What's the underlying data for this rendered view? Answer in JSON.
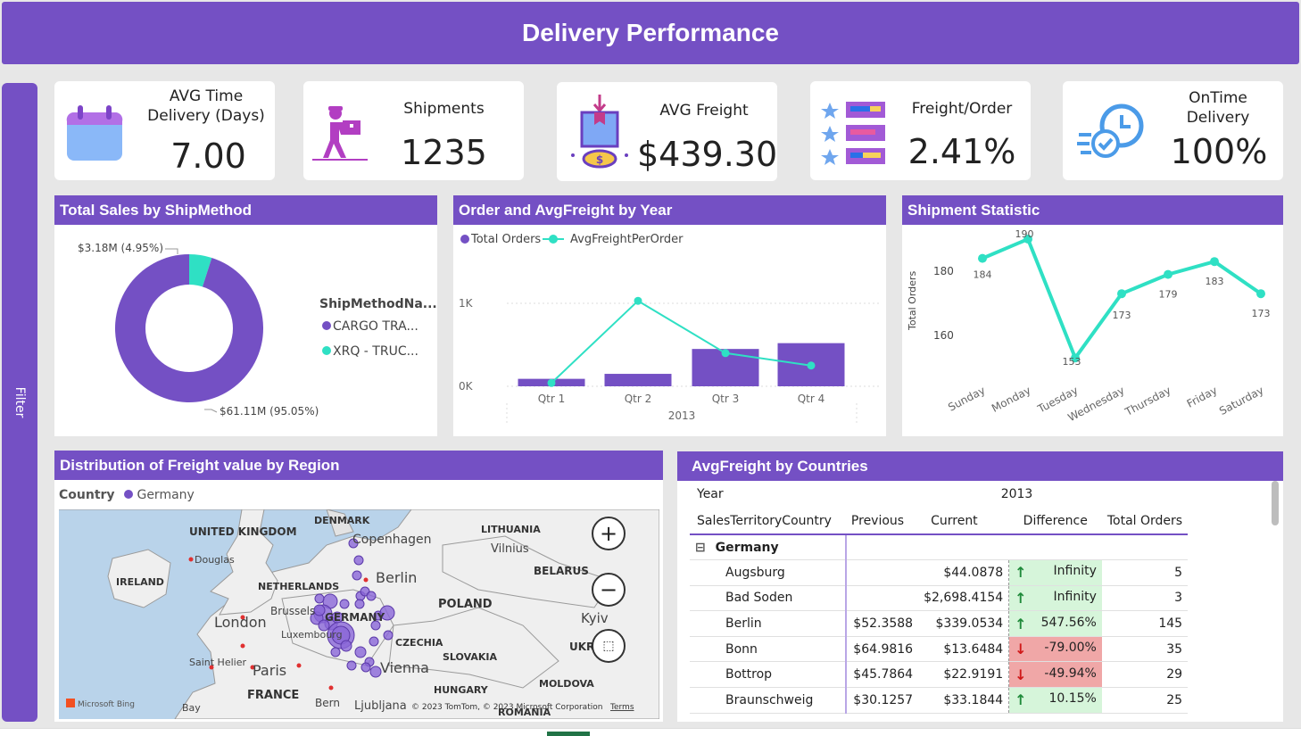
{
  "header": {
    "title": "Delivery Performance"
  },
  "filter": {
    "label": "Filter"
  },
  "kpis": {
    "avg_time": {
      "label_line1": "AVG Time",
      "label_line2": "Delivery (Days)",
      "value": "7.00",
      "icon": "calendar-icon"
    },
    "shipments": {
      "label": "Shipments",
      "value": "1235",
      "icon": "delivery-person-icon"
    },
    "avg_freight": {
      "label": "AVG Freight",
      "value": "$439.30",
      "icon": "package-money-icon"
    },
    "freight_order": {
      "label": "Freight/Order",
      "value": "2.41%",
      "icon": "star-list-icon"
    },
    "ontime": {
      "label_line1": "OnTime",
      "label_line2": "Delivery",
      "value": "100%",
      "icon": "fast-clock-icon"
    }
  },
  "colors": {
    "purple": "#7450c4",
    "teal": "#2fe0c4",
    "up_bg": "#d6f5da",
    "down_bg": "#f0a7a7"
  },
  "donut": {
    "title": "Total Sales by ShipMethod",
    "legend_title": "ShipMethodNa...",
    "label_small": "$3.18M (4.95%)",
    "label_large": "$61.11M (95.05%)",
    "legend": [
      "CARGO TRA...",
      "XRQ - TRUC..."
    ]
  },
  "combo": {
    "title": "Order and AvgFreight by Year",
    "legend_orders": "Total Orders",
    "legend_freight": "AvgFreightPerOrder",
    "y_ticks": [
      "1K",
      "0K"
    ],
    "year": "2013"
  },
  "shipstat": {
    "title": "Shipment Statistic",
    "ylabel": "Total Orders",
    "y_ticks": [
      "180",
      "160"
    ]
  },
  "map": {
    "title": "Distribution of Freight value by Region",
    "legend_field": "Country",
    "legend_item": "Germany",
    "labels": {
      "uk": "UNITED KINGDOM",
      "denmark": "DENMARK",
      "copenhagen": "Copenhagen",
      "lithuania": "LITHUANIA",
      "vilnius": "Vilnius",
      "belarus": "BELARUS",
      "ireland": "IRELAND",
      "netherlands": "NETHERLANDS",
      "berlin": "Berlin",
      "poland": "POLAND",
      "london": "London",
      "brussels": "Brussels",
      "germany": "GERMANY",
      "kyiv": "Kyiv",
      "luxembourg": "Luxembourg",
      "czechia": "CZECHIA",
      "ukr": "UKR",
      "saint_helier": "Saint Helier",
      "paris": "Paris",
      "vienna": "Vienna",
      "slovakia": "SLOVAKIA",
      "france": "FRANCE",
      "hungary": "HUNGARY",
      "moldova": "MOLDOVA",
      "bay": "Bay",
      "bern": "Bern",
      "ljubljana": "Ljubljana",
      "romania": "ROMANIA",
      "douglas": "Douglas",
      "bing": "Microsoft Bing",
      "copyright": "© 2023 TomTom, © 2023 Microsoft Corporation",
      "terms": "Terms"
    }
  },
  "table": {
    "title": "AvgFreight by Countries",
    "year_label": "Year",
    "year_value": "2013",
    "columns": [
      "SalesTerritoryCountry",
      "Previous",
      "Current",
      "Difference",
      "Total Orders"
    ],
    "group": "Germany",
    "expand_icon": "⊟",
    "rows": [
      {
        "city": "Augsburg",
        "previous": "",
        "current": "$44.0878",
        "difference": "Infinity",
        "trend": "up",
        "orders": "5"
      },
      {
        "city": "Bad Soden",
        "previous": "",
        "current": "$2,698.4154",
        "difference": "Infinity",
        "trend": "up",
        "orders": "3"
      },
      {
        "city": "Berlin",
        "previous": "$52.3588",
        "current": "$339.0534",
        "difference": "547.56%",
        "trend": "up",
        "orders": "145"
      },
      {
        "city": "Bonn",
        "previous": "$64.9816",
        "current": "$13.6484",
        "difference": "-79.00%",
        "trend": "down",
        "orders": "35"
      },
      {
        "city": "Bottrop",
        "previous": "$45.7864",
        "current": "$22.9191",
        "difference": "-49.94%",
        "trend": "down",
        "orders": "29"
      },
      {
        "city": "Braunschweig",
        "previous": "$30.1257",
        "current": "$33.1844",
        "difference": "10.15%",
        "trend": "up",
        "orders": "25"
      }
    ]
  },
  "chart_data": [
    {
      "type": "pie",
      "title": "Total Sales by ShipMethod",
      "categories": [
        "CARGO TRA...",
        "XRQ - TRUC..."
      ],
      "values": [
        61.11,
        3.18
      ],
      "percent": [
        95.05,
        4.95
      ],
      "unit": "$M"
    },
    {
      "type": "bar",
      "title": "Order and AvgFreight by Year",
      "categories": [
        "Qtr 1",
        "Qtr 2",
        "Qtr 3",
        "Qtr 4"
      ],
      "series": [
        {
          "name": "Total Orders",
          "type": "bar",
          "values": [
            90,
            150,
            450,
            520
          ]
        },
        {
          "name": "AvgFreightPerOrder",
          "type": "line",
          "values": [
            40,
            1030,
            400,
            250
          ]
        }
      ],
      "ylim": [
        0,
        1200
      ]
    },
    {
      "type": "line",
      "title": "Shipment Statistic",
      "ylabel": "Total Orders",
      "categories": [
        "Sunday",
        "Monday",
        "Tuesday",
        "Wednesday",
        "Thursday",
        "Friday",
        "Saturday"
      ],
      "values": [
        184,
        190,
        153,
        173,
        179,
        183,
        173
      ],
      "ylim": [
        150,
        195
      ]
    }
  ]
}
